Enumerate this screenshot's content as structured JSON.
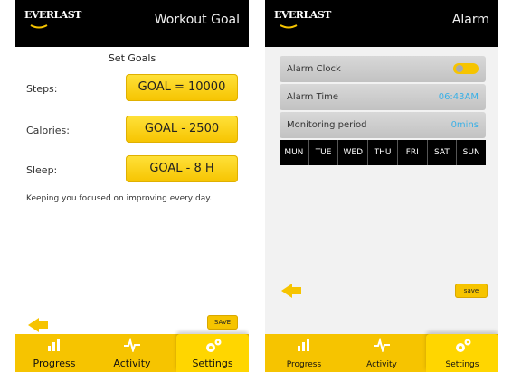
{
  "screen1": {
    "logo_text": "EVERLAST",
    "title": "Workout Goal",
    "set_goals_heading": "Set Goals",
    "rows": [
      {
        "label": "Steps:",
        "value": "GOAL = 10000"
      },
      {
        "label": "Calories:",
        "value": "GOAL - 2500"
      },
      {
        "label": "Sleep:",
        "value": "GOAL - 8 H"
      }
    ],
    "note": "Keeping you focused on improving every day.",
    "save_label": "SAVE",
    "nav": [
      {
        "label": "Progress",
        "icon": "bar-chart-icon"
      },
      {
        "label": "Activity",
        "icon": "pulse-icon"
      },
      {
        "label": "Settings",
        "icon": "gear-icon"
      }
    ]
  },
  "screen2": {
    "logo_text": "EVERLAST",
    "title": "Alarm",
    "settings": [
      {
        "label": "Alarm Clock",
        "value": ""
      },
      {
        "label": "Alarm Time",
        "value": "06:43AM"
      },
      {
        "label": "Monitoring period",
        "value": "0mins"
      }
    ],
    "days": [
      "MUN",
      "TUE",
      "WED",
      "THU",
      "FRI",
      "SAT",
      "SUN"
    ],
    "save_label": "save",
    "nav": [
      {
        "label": "Progress",
        "icon": "bar-chart-icon"
      },
      {
        "label": "Activity",
        "icon": "pulse-icon"
      },
      {
        "label": "Settings",
        "icon": "gear-icon"
      }
    ]
  },
  "colors": {
    "accent": "#f6c400",
    "value_blue": "#3ab0e6"
  }
}
